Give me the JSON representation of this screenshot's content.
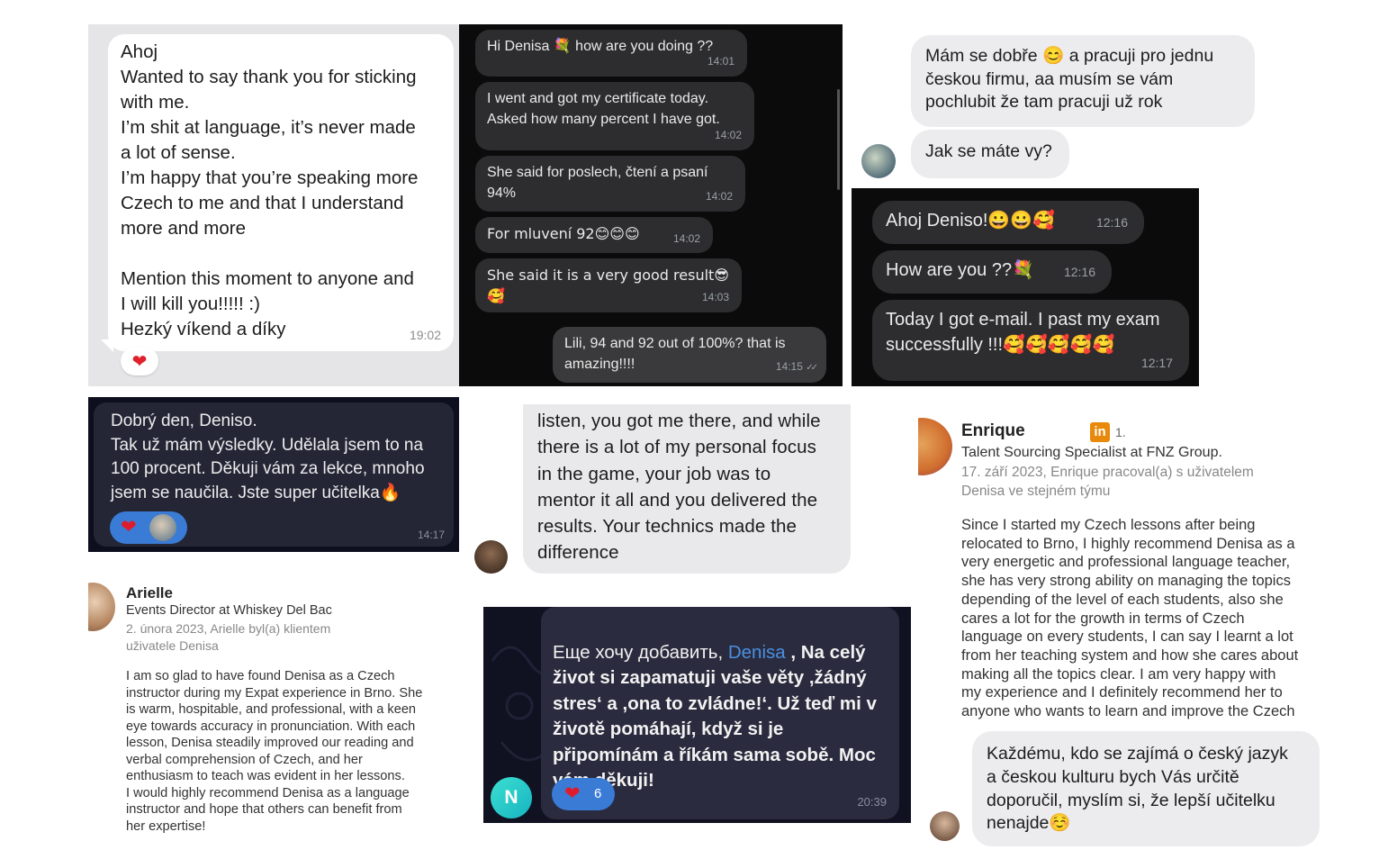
{
  "chat_whatsapp_en": {
    "message": "Ahoj\nWanted to say thank you for sticking\nwith me.\nI’m shit at language, it’s never made\na lot of sense.\nI’m happy that you’re speaking more\nCzech to me and that I understand\nmore and more\n\nMention this moment to anyone and\nI will kill you!!!!! :)\nHezký víkend a díky",
    "time": "19:02",
    "reaction": "❤"
  },
  "chat_dark_exam": {
    "messages": [
      {
        "text": "Hi Denisa 💐 how are you doing ??",
        "time": "14:01"
      },
      {
        "text": "I went and got my certificate today.\nAsked how many percent I have got.",
        "time": "14:02"
      },
      {
        "text": "She said for poslech, čtení a psaní\n94%",
        "time": "14:02"
      },
      {
        "text": "For mluvení 92😊😊😊",
        "time": "14:02"
      },
      {
        "text": "She said it is a very good result😎\n🥰",
        "time": "14:03"
      }
    ],
    "reply": {
      "text": "Lili, 94 and 92 out of 100%? that is\namazing!!!!",
      "time": "14:15",
      "ticks": "✓✓"
    }
  },
  "chat_cz_light": {
    "message_1": "Mám se dobře  😊 a pracuji pro jednu\nčeskou firmu, aa musím se vám\npochlubit že  tam pracuji už rok",
    "message_2": "Jak se máte vy?"
  },
  "chat_dark_email": {
    "messages": [
      {
        "text": "Ahoj Deniso!😀😀🥰",
        "time": "12:16"
      },
      {
        "text": "How are you ??💐",
        "time": "12:16"
      },
      {
        "text": "Today I got e-mail. I past my exam\nsuccessfully !!!🥰🥰🥰🥰🥰",
        "time": "12:17"
      }
    ]
  },
  "chat_telegram_results": {
    "message": "Dobrý den, Deniso.\nTak už mám výsledky. Udělala jsem to na\n100 procent. Děkuji vám za lekce, mnoho\njsem se naučila. Jste super učitelka🔥",
    "time": "14:17",
    "reaction": "❤"
  },
  "chat_mentor": {
    "message": "listen, you got me there, and while\nthere is a lot of my personal focus\nin the game, your job was to\nmentor it all and you delivered the\nresults. Your technics made the\ndifference"
  },
  "review_enrique": {
    "name": "Enrique",
    "linkedin_badge": "in",
    "degree": "1.",
    "headline": "Talent Sourcing Specialist at FNZ Group.",
    "meta": "17. září 2023, Enrique pracoval(a) s uživatelem\nDenisa ve stejném týmu",
    "body": "Since I started my Czech lessons after being\nrelocated to Brno, I highly recommend Denisa as a\nvery energetic and professional language teacher,\nshe has very strong ability on managing the topics\ndepending of the level of each students, also she\ncares a lot for the growth in terms of Czech\nlanguage on every students, I can say I learnt a lot\nfrom her teaching system and how she cares about\nmaking all the topics clear. I am very happy with\nmy experience and I definitely recommend her to\nanyone who wants to learn and improve the Czech"
  },
  "review_arielle": {
    "name": "Arielle",
    "headline": "Events Director at Whiskey Del Bac",
    "meta": "2. února 2023, Arielle byl(a) klientem\nuživatele Denisa",
    "body": "I am so glad to have found Denisa as a Czech\ninstructor during my Expat experience in Brno. She\nis warm, hospitable, and professional, with a keen\neye towards accuracy in pronunciation. With each\nlesson, Denisa steadily improved our reading and\nverbal comprehension of Czech, and her\nenthusiasm to teach was evident in her lessons.\nI would highly recommend Denisa as a language\ninstructor and hope that others can benefit from\nher expertise!"
  },
  "chat_telegram_ru": {
    "prefix": "Еще хочу добавить, ",
    "mention": "Denisa",
    "text": " , Na celý\nživot si zapamatuji vaše věty ,žádný\nstres‘ a ,ona to zvládne!‘. Už teď mi v\nživotě pomáhají, když si je\npřipomínám a říkám sama sobě. Moc\nvám děkuji!",
    "avatar_letter": "N",
    "reaction": "❤",
    "reaction_count": "6",
    "time": "20:39"
  },
  "chat_cz_recommend": {
    "message": "Každému, kdo se zajímá o český jazyk\na českou kulturu bych Vás určitě\ndoporučil, myslím si, že lepší učitelku\nnenajde☺️"
  },
  "colors": {
    "dark_bg": "#0b0b0c",
    "dark_bubble": "#2d2d2f",
    "light_bubble": "#ececee",
    "telegram_bubble": "#2b2b3d",
    "reaction_blue": "#3a7bd5",
    "mention_blue": "#4a90e2",
    "linkedin_orange": "#e8890c"
  }
}
